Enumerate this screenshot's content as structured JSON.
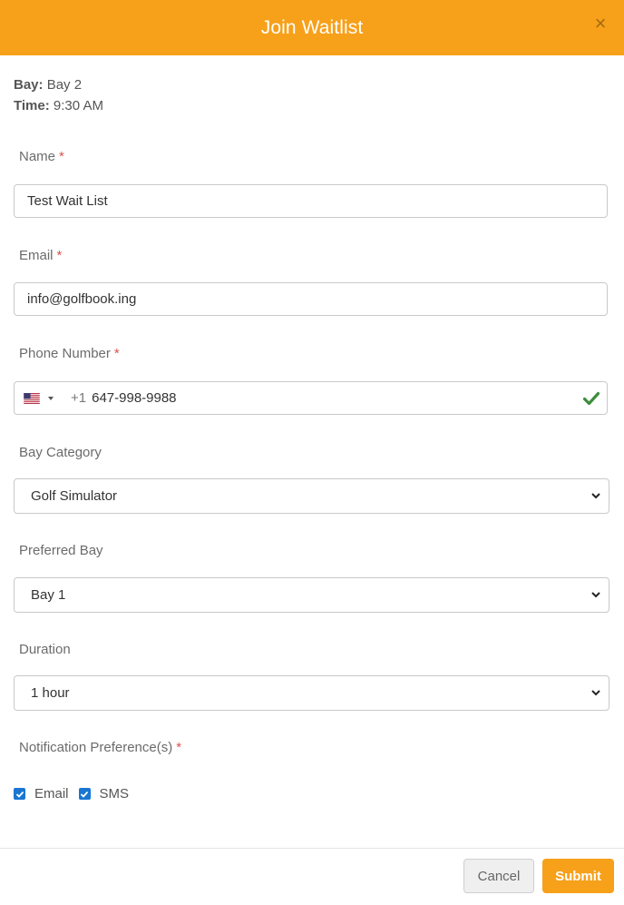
{
  "modal": {
    "title": "Join Waitlist",
    "close_glyph": "×"
  },
  "info": {
    "bay_label": "Bay:",
    "bay_value": "Bay 2",
    "time_label": "Time:",
    "time_value": "9:30 AM"
  },
  "form": {
    "name": {
      "label": "Name",
      "required": "*",
      "value": "Test Wait List"
    },
    "email": {
      "label": "Email",
      "required": "*",
      "value": "info@golfbook.ing"
    },
    "phone": {
      "label": "Phone Number",
      "required": "*",
      "dial_code": "+1",
      "value": "647-998-9988",
      "valid_icon": "check-icon"
    },
    "bay_category": {
      "label": "Bay Category",
      "selected": "Golf Simulator"
    },
    "preferred_bay": {
      "label": "Preferred Bay",
      "selected": "Bay 1"
    },
    "duration": {
      "label": "Duration",
      "selected": "1 hour"
    },
    "notifications": {
      "label": "Notification Preference(s)",
      "required": "*",
      "options": [
        {
          "label": "Email",
          "checked": true
        },
        {
          "label": "SMS",
          "checked": true
        }
      ]
    }
  },
  "footer": {
    "cancel_label": "Cancel",
    "submit_label": "Submit"
  },
  "colors": {
    "accent": "#f7a01a",
    "required": "#d9534f",
    "checkbox": "#1976d2",
    "valid": "#3c8d3c"
  }
}
